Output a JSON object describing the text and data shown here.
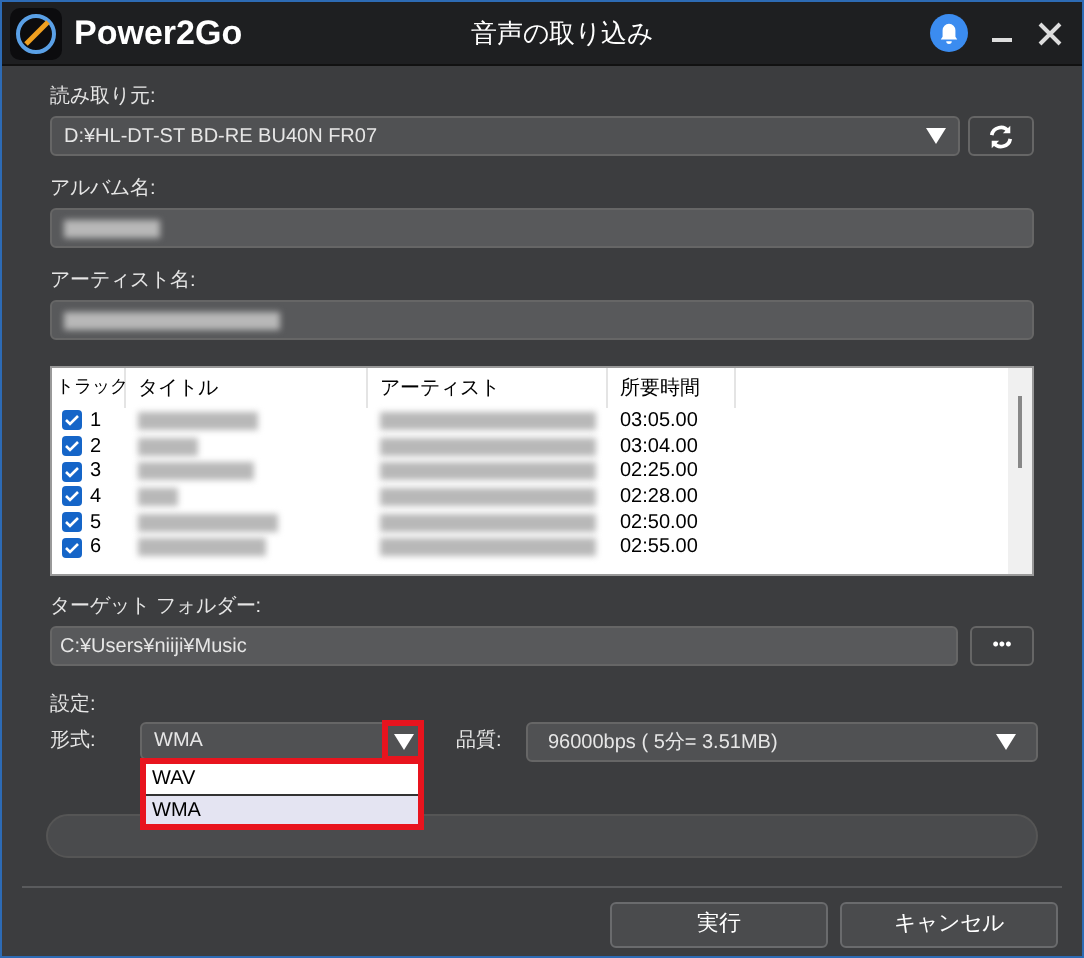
{
  "window": {
    "app_name": "Power2Go",
    "title": "音声の取り込み"
  },
  "source": {
    "label": "読み取り元:",
    "value": "D:¥HL-DT-ST BD-RE BU40N FR07"
  },
  "album": {
    "label": "アルバム名:"
  },
  "artist": {
    "label": "アーティスト名:"
  },
  "tracks": {
    "columns": [
      "トラック",
      "タイトル",
      "アーティスト",
      "所要時間"
    ],
    "rows": [
      {
        "number": "1",
        "checked": true,
        "duration": "03:05.00"
      },
      {
        "number": "2",
        "checked": true,
        "duration": "03:04.00"
      },
      {
        "number": "3",
        "checked": true,
        "duration": "02:25.00"
      },
      {
        "number": "4",
        "checked": true,
        "duration": "02:28.00"
      },
      {
        "number": "5",
        "checked": true,
        "duration": "02:50.00"
      },
      {
        "number": "6",
        "checked": true,
        "duration": "02:55.00"
      }
    ]
  },
  "target_folder": {
    "label": "ターゲット フォルダー:",
    "value": "C:¥Users¥niiji¥Music",
    "browse": "•••"
  },
  "settings": {
    "label": "設定:",
    "format_label": "形式:",
    "format_value": "WMA",
    "arrow_highlighted": true,
    "format_options": [
      {
        "label": "WAV",
        "selected": false
      },
      {
        "label": "WMA",
        "selected": true
      }
    ],
    "options_highlighted": true,
    "quality_label": "品質:",
    "quality_value": "96000bps ( 5分= 3.51MB)"
  },
  "progress": {
    "level": 0
  },
  "buttons": [
    "実行",
    "キャンセル"
  ]
}
